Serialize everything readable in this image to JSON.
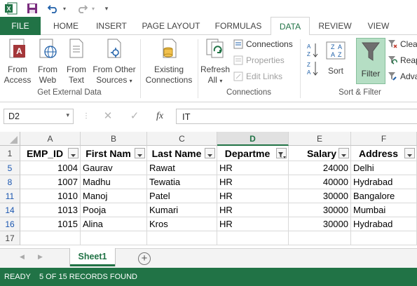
{
  "qat": {
    "app_icon": "excel-logo-icon",
    "save_icon": "save-icon",
    "undo_icon": "undo-icon",
    "redo_icon": "redo-icon",
    "customize_icon": "customize-qat-icon"
  },
  "tabs": [
    {
      "label": "FILE"
    },
    {
      "label": "HOME"
    },
    {
      "label": "INSERT"
    },
    {
      "label": "PAGE LAYOUT"
    },
    {
      "label": "FORMULAS"
    },
    {
      "label": "DATA"
    },
    {
      "label": "REVIEW"
    },
    {
      "label": "VIEW"
    }
  ],
  "ribbon": {
    "get_external": {
      "from_access": [
        "From",
        "Access"
      ],
      "from_web": [
        "From",
        "Web"
      ],
      "from_text": [
        "From",
        "Text"
      ],
      "from_other": [
        "From Other",
        "Sources"
      ],
      "label": "Get External Data"
    },
    "existing": [
      "Existing",
      "Connections"
    ],
    "connections": {
      "refresh": [
        "Refresh",
        "All"
      ],
      "connections": "Connections",
      "properties": "Properties",
      "edit_links": "Edit Links",
      "label": "Connections"
    },
    "sort_filter": {
      "sort": "Sort",
      "filter": "Filter",
      "clear": "Clea",
      "reapply": "Reap",
      "advanced": "Adva",
      "label": "Sort & Filter"
    },
    "accent": "#217346"
  },
  "formula_bar": {
    "name_box": "D2",
    "fx": "fx",
    "content": "IT"
  },
  "columns": [
    "A",
    "B",
    "C",
    "D",
    "E",
    "F"
  ],
  "selected_column": "D",
  "headers": [
    "EMP_ID",
    "First Nam",
    "Last Name",
    "Departme",
    "Salary",
    "Address"
  ],
  "rows": [
    {
      "num": "5",
      "cells": [
        "1004",
        "Gaurav",
        "Rawat",
        "HR",
        "24000",
        "Delhi"
      ]
    },
    {
      "num": "8",
      "cells": [
        "1007",
        "Madhu",
        "Tewatia",
        "HR",
        "40000",
        "Hydrabad"
      ]
    },
    {
      "num": "11",
      "cells": [
        "1010",
        "Manoj",
        "Patel",
        "HR",
        "30000",
        "Bangalore"
      ]
    },
    {
      "num": "14",
      "cells": [
        "1013",
        "Pooja",
        "Kumari",
        "HR",
        "30000",
        "Mumbai"
      ]
    },
    {
      "num": "16",
      "cells": [
        "1015",
        "Alina",
        "Kros",
        "HR",
        "30000",
        "Hydrabad"
      ]
    }
  ],
  "header_row_num": "1",
  "empty_row_num": "17",
  "sheet": {
    "name": "Sheet1"
  },
  "status": {
    "ready": "READY",
    "records": "5 OF 15 RECORDS FOUND"
  }
}
